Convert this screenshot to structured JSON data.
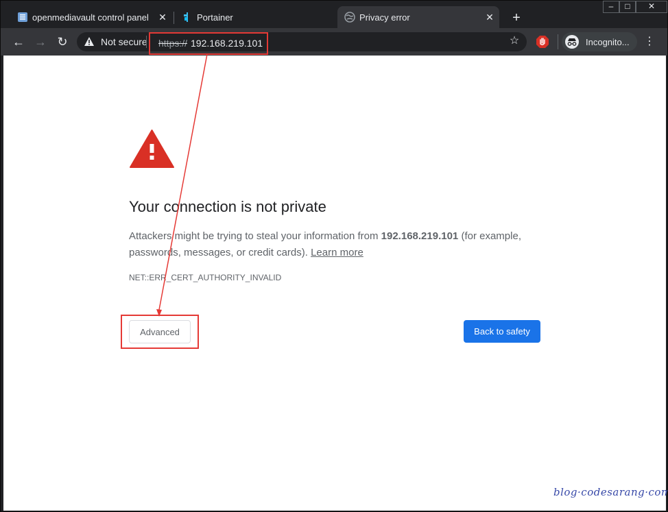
{
  "tabs": [
    {
      "label": "openmediavault control panel - I",
      "close": "✕",
      "icon": "document-icon",
      "active": false
    },
    {
      "label": "Portainer",
      "close": "✕",
      "icon": "portainer-icon",
      "active": false
    },
    {
      "label": "Privacy error",
      "close": "✕",
      "icon": "globe-icon",
      "active": true
    }
  ],
  "new_tab": "+",
  "window_controls": {
    "minimize": "–",
    "maximize": "□",
    "close": "✕"
  },
  "toolbar": {
    "back": "←",
    "forward": "→",
    "reload": "↻",
    "not_secure": "Not secure",
    "url_scheme": "https://",
    "url_host": "192.168.219.101",
    "bookmark": "☆",
    "extension_icon": "stop-hand-icon",
    "profile_label": "Incognito...",
    "menu": "⋮"
  },
  "page": {
    "heading": "Your connection is not private",
    "body_prefix": "Attackers might be trying to steal your information from ",
    "host": "192.168.219.101",
    "body_suffix": " (for example, passwords, messages, or credit cards). ",
    "learn_more": "Learn more",
    "error_code": "NET::ERR_CERT_AUTHORITY_INVALID",
    "advanced_button": "Advanced",
    "back_button": "Back to safety"
  },
  "watermark": "blog·codesarang·com",
  "colors": {
    "annotation_red": "#e53935",
    "primary_button": "#1a73e8",
    "warning_red": "#d93025",
    "frame_dark": "#202124",
    "toolbar": "#35363a"
  }
}
